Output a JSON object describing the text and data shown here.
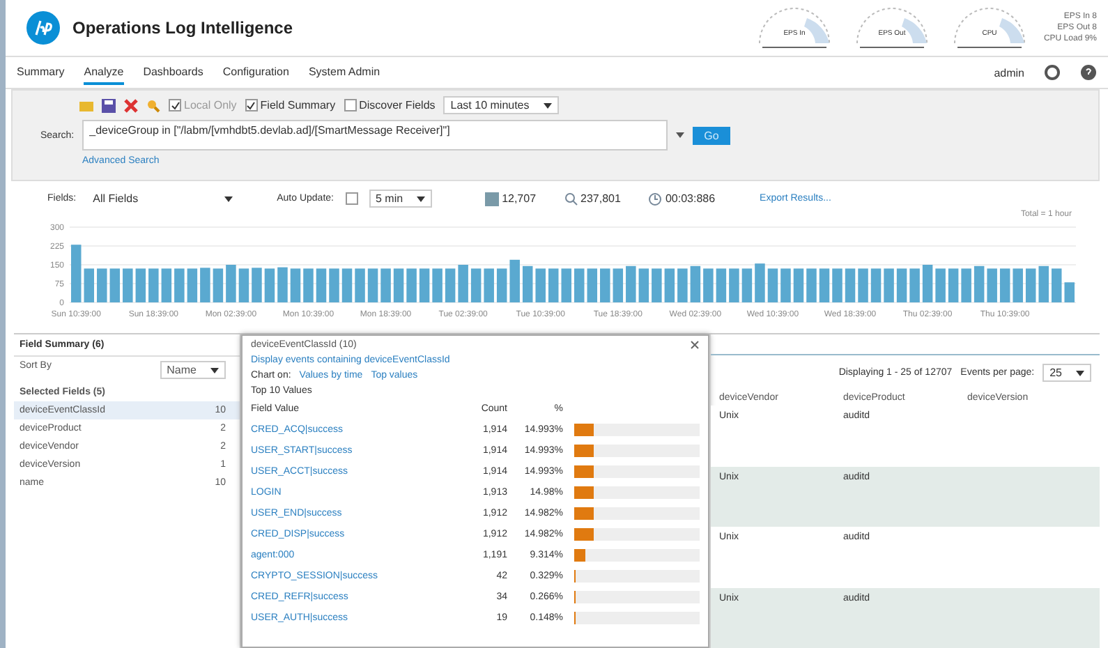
{
  "header": {
    "title": "Operations Log Intelligence",
    "gauges": [
      {
        "label": "EPS In"
      },
      {
        "label": "EPS Out"
      },
      {
        "label": "CPU"
      }
    ],
    "stats": [
      "EPS In 8",
      "EPS Out 8",
      "CPU Load 9%"
    ]
  },
  "tabs": [
    {
      "label": "Summary",
      "selected": false
    },
    {
      "label": "Analyze",
      "selected": true
    },
    {
      "label": "Dashboards",
      "selected": false
    },
    {
      "label": "Configuration",
      "selected": false
    },
    {
      "label": "System Admin",
      "selected": false
    }
  ],
  "user": "admin",
  "toolbar": {
    "options": [
      {
        "label": "Local Only",
        "checked": true,
        "disabled": true
      },
      {
        "label": "Field Summary",
        "checked": true,
        "disabled": false
      },
      {
        "label": "Discover Fields",
        "checked": false,
        "disabled": false
      }
    ],
    "time_range": "Last 10 minutes"
  },
  "search": {
    "label": "Search:",
    "value": "_deviceGroup in [\"/labm/[vmhdbt5.devlab.ad]/[SmartMessage Receiver]\"]",
    "button": "Go",
    "advanced_link": "Advanced Search"
  },
  "fields_bar": {
    "fields_label": "Fields:",
    "fields_value": "All Fields",
    "auto_update_label": "Auto Update:",
    "auto_update": false,
    "interval": "5 min",
    "events": "12,707",
    "scanned": "237,801",
    "duration": "00:03:886",
    "export_link": "Export Results..."
  },
  "histogram": {
    "range_label": "Total = 1 hour",
    "chart_data": {
      "type": "bar",
      "grid": true,
      "yticks": [
        0,
        75,
        150,
        225,
        300
      ],
      "ylim": [
        0,
        300
      ],
      "categories": [
        "Sun 10:39:00",
        null,
        null,
        null,
        null,
        null,
        "Sun 18:39:00",
        null,
        null,
        null,
        null,
        null,
        "Mon 02:39:00",
        null,
        null,
        null,
        null,
        null,
        "Mon 10:39:00",
        null,
        null,
        null,
        null,
        null,
        "Mon 18:39:00",
        null,
        null,
        null,
        null,
        null,
        "Tue 02:39:00",
        null,
        null,
        null,
        null,
        null,
        "Tue 10:39:00",
        null,
        null,
        null,
        null,
        null,
        "Tue 18:39:00",
        null,
        null,
        null,
        null,
        null,
        "Wed 02:39:00",
        null,
        null,
        null,
        null,
        null,
        "Wed 10:39:00",
        null,
        null,
        null,
        null,
        null,
        "Wed 18:39:00",
        null,
        null,
        null,
        null,
        null,
        "Thu 02:39:00",
        null,
        null,
        null,
        null,
        null,
        "Thu 10:39:00",
        null,
        null,
        null,
        null,
        null
      ],
      "values": [
        230,
        135,
        135,
        135,
        135,
        135,
        135,
        135,
        135,
        135,
        138,
        135,
        150,
        135,
        138,
        135,
        140,
        135,
        135,
        135,
        135,
        135,
        135,
        135,
        135,
        135,
        135,
        135,
        135,
        135,
        150,
        135,
        135,
        135,
        170,
        145,
        135,
        135,
        135,
        135,
        135,
        135,
        135,
        145,
        135,
        135,
        135,
        135,
        145,
        135,
        135,
        135,
        135,
        155,
        135,
        135,
        135,
        135,
        135,
        135,
        135,
        135,
        135,
        135,
        135,
        135,
        150,
        135,
        135,
        135,
        145,
        135,
        135,
        135,
        135,
        145,
        135,
        80
      ]
    }
  },
  "field_summary": {
    "title": "Field Summary (6)",
    "sort_label": "Sort By",
    "sort_value": "Name",
    "section": "Selected Fields (5)",
    "items": [
      {
        "name": "deviceEventClassId",
        "count": "10",
        "selected": true
      },
      {
        "name": "deviceProduct",
        "count": "2",
        "selected": false
      },
      {
        "name": "deviceVendor",
        "count": "2",
        "selected": false
      },
      {
        "name": "deviceVersion",
        "count": "1",
        "selected": false
      },
      {
        "name": "name",
        "count": "10",
        "selected": false
      }
    ]
  },
  "popup": {
    "title": "deviceEventClassId (10)",
    "display_link": "Display events containing deviceEventClassId",
    "chart_on_label": "Chart on:",
    "chart_links": [
      "Values by time",
      "Top values"
    ],
    "section": "Top 10 Values",
    "columns": [
      "Field Value",
      "Count",
      "%"
    ],
    "rows": [
      {
        "value": "CRED_ACQ|success",
        "count": "1,914",
        "percent": "14.993%",
        "level": 0.15
      },
      {
        "value": "USER_START|success",
        "count": "1,914",
        "percent": "14.993%",
        "level": 0.15
      },
      {
        "value": "USER_ACCT|success",
        "count": "1,914",
        "percent": "14.993%",
        "level": 0.15
      },
      {
        "value": "LOGIN",
        "count": "1,913",
        "percent": "14.98%",
        "level": 0.15
      },
      {
        "value": "USER_END|success",
        "count": "1,912",
        "percent": "14.982%",
        "level": 0.15
      },
      {
        "value": "CRED_DISP|success",
        "count": "1,912",
        "percent": "14.982%",
        "level": 0.15
      },
      {
        "value": "agent:000",
        "count": "1,191",
        "percent": "9.314%",
        "level": 0.093
      },
      {
        "value": "CRYPTO_SESSION|success",
        "count": "42",
        "percent": "0.329%",
        "level": 0.003
      },
      {
        "value": "CRED_REFR|success",
        "count": "34",
        "percent": "0.266%",
        "level": 0.003
      },
      {
        "value": "USER_AUTH|success",
        "count": "19",
        "percent": "0.148%",
        "level": 0.001
      }
    ]
  },
  "events": {
    "displaying": "Displaying 1 - 25 of 12707",
    "per_page_label": "Events per page:",
    "per_page": "25",
    "columns": [
      "deviceVendor",
      "deviceProduct",
      "deviceVersion"
    ],
    "rows": [
      [
        "Unix",
        "auditd"
      ],
      [
        "Unix",
        "auditd"
      ],
      [
        "Unix",
        "auditd"
      ],
      [
        "Unix",
        "auditd"
      ]
    ]
  }
}
